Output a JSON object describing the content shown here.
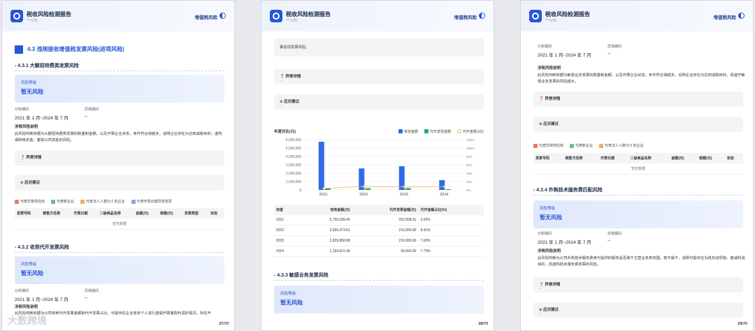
{
  "header": {
    "title": "税收风险检测报告",
    "subtitle": "***公司",
    "tag": "增值税风险"
  },
  "p1": {
    "h3": "4.3 违规接收增值税发票风险(进项风险)",
    "s1": "4.3.1 大额招待费类发票风险",
    "risk_label": "风险等级",
    "risk_value": "暂无风险",
    "period_label": "分析期间",
    "abn_label": "异常期间",
    "period": "2021 年 1 月~2024 年 7 月",
    "abn": "--",
    "rule_label": "涉税风险说明",
    "rule": "此风险判断依据为大额招待费类发票的数量和金额，以及开票企业状态。条件符合得越多，说明企业存在为达到减税目的，虚构或转移资金，套取公司资金的风险。",
    "detail": "异常详情",
    "detail_v": "--",
    "advice": "应对建议",
    "advice_v": "--",
    "legend": [
      "代表异常供应商",
      "代表新企业",
      "代表法人人数为 0 的企业",
      "代表开票日期异常发票"
    ],
    "cols": [
      "发票号码",
      "销售方名称",
      "开票日期",
      "二级商品名称",
      "金额(元)",
      "税额(元)",
      "发票类型",
      "状态"
    ],
    "empty": "暂无数据",
    "s2": "4.3.2 收到代开发票风险",
    "risk_label2": "风险等级",
    "risk_value2": "暂无风险",
    "period2": "2021 年 1 月~2024 年 7 月",
    "abn2": "--",
    "rule_label2": "涉税风险说明",
    "rule2": "此风险判断依据为公司收到代开发票金额和代开发票占比，可能存在企业收受个人进行虚假开票套取利润的情况。存在开",
    "page": "27/70"
  },
  "p2": {
    "top": "票进项发票风险。",
    "detail": "异常详情",
    "detail_v": "--",
    "advice": "应对建议",
    "advice_v": "--",
    "chart_title": "年度对比(元)",
    "legend": [
      "有效金额",
      "代开发票金额",
      "代开金额占比"
    ],
    "cols": [
      "年度",
      "有效金额(元)",
      "代开发票金额(元)",
      "代开金额占比(%)"
    ],
    "rows": [
      [
        "2021",
        "5,750,039.45",
        "202,908.91",
        "3.53%"
      ],
      [
        "2022",
        "2,566,973.91",
        "216,000.00",
        "8.41%"
      ],
      [
        "2023",
        "2,829,868.88",
        "216,000.00",
        "7.63%"
      ],
      [
        "2024",
        "1,164,621.38",
        "90,000.00",
        "7.73%"
      ]
    ],
    "s3": "4.3.3 敏感业务发票风险",
    "risk_label": "风险等级",
    "risk_value": "暂无风险",
    "page": "28/70"
  },
  "p3": {
    "period_label": "分析期间",
    "abn_label": "异常期间",
    "period": "2021 年 1 月~2024 年 7 月",
    "abn": "--",
    "rule_label": "涉税风险说明",
    "rule": "此风险判断依据为敏感业务发票的数量和金额，以及开票企业状态。条件符合得越多，说明企业存在为达到减税目的，而虚开敏感业务发票的风险越大。",
    "detail": "异常详情",
    "detail_v": "--",
    "advice": "应对建议",
    "advice_v": "--",
    "legend": [
      "代表异常供应商",
      "代表新企业",
      "代表法人人数为 0 的企业"
    ],
    "cols": [
      "发票号码",
      "销售方名称",
      "开票日期",
      "二级商品名称",
      "金额(元)",
      "税额(元)",
      "状态"
    ],
    "empty": "暂无数据",
    "s4": "4.3.4 外购技术服务费匹配风险",
    "risk_label": "风险等级",
    "risk_value": "暂无风险",
    "period2": "2021 年 1 月~2024 年 7 月",
    "abn2": "--",
    "rule_label2": "涉税风险说明",
    "rule2": "此风险判断为公司外购技术服务费用与提供的服务是否属于主营业务类范围。若不属于，说明可能存在为抵扣进项税、套减利润目的，而虚构技术服务费发票的风险。",
    "detail2": "异常详情",
    "detail2_v": "--",
    "advice2": "应对建议",
    "advice2_v": "--",
    "page": "29/70"
  },
  "watermark": "大数跨境",
  "chart_data": {
    "type": "bar",
    "title": "年度对比(元)",
    "categories": [
      "2021",
      "2022",
      "2023",
      "2024"
    ],
    "series": [
      {
        "name": "有效金额",
        "values": [
          5750039.45,
          2566973.91,
          2829868.88,
          1164621.38
        ]
      },
      {
        "name": "代开发票金额",
        "values": [
          202908.91,
          216000,
          216000,
          90000
        ]
      },
      {
        "name": "代开金额占比",
        "values": [
          3.53,
          8.41,
          7.63,
          7.73
        ],
        "axis": "right"
      }
    ],
    "ylim": [
      0,
      6000000
    ],
    "yticks": [
      "0",
      "1,000,000",
      "2,000,000",
      "3,000,000",
      "4,000,000",
      "5,000,000",
      "6,000,000"
    ],
    "y2ticks": [
      "0%",
      "20%",
      "40%",
      "60%",
      "80%",
      "100%",
      "120%"
    ],
    "colors": [
      "#2f6be8",
      "#2ea86b",
      "#f0b060"
    ]
  }
}
